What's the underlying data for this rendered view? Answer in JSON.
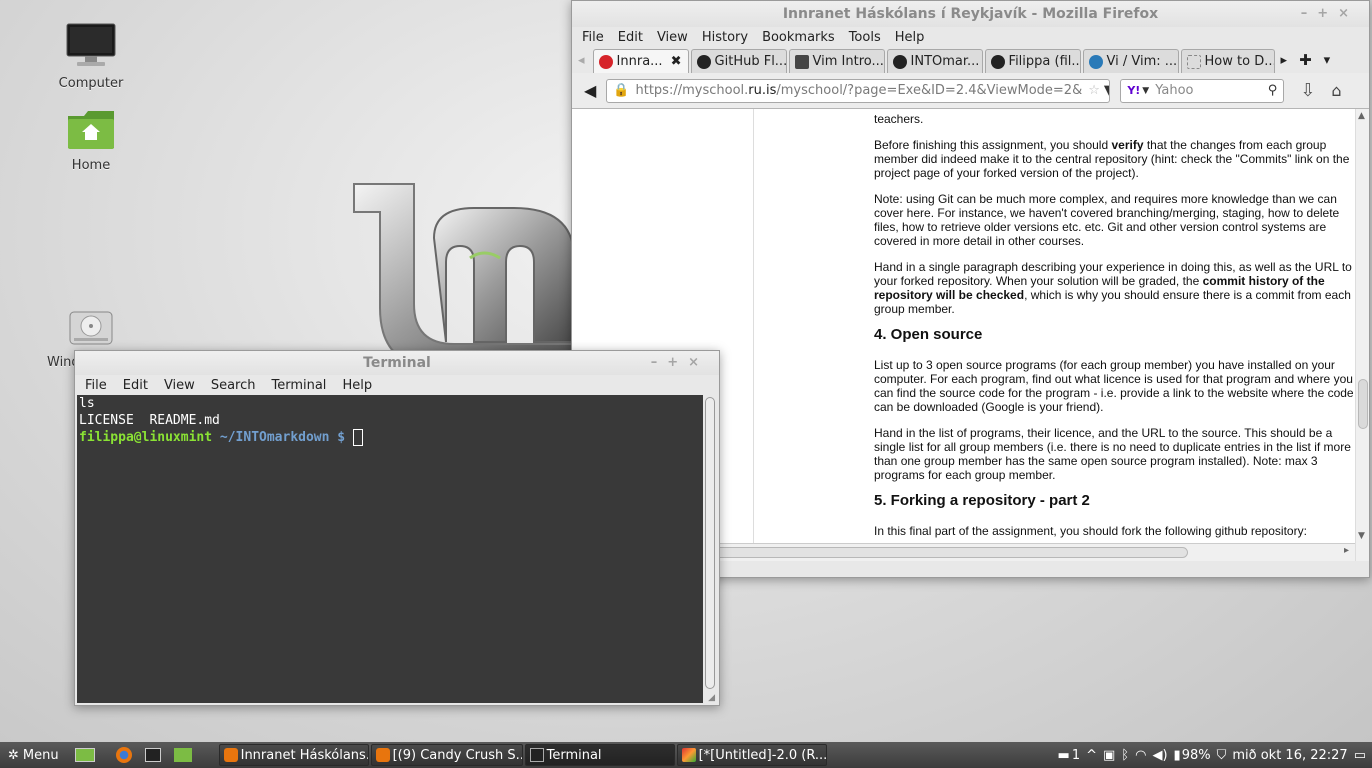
{
  "desktop": {
    "icons": [
      {
        "label": "Computer"
      },
      {
        "label": "Home"
      },
      {
        "label": "Wind"
      }
    ]
  },
  "firefox": {
    "title": "Innranet Háskólans í Reykjavík - Mozilla Firefox",
    "menu": [
      "File",
      "Edit",
      "View",
      "History",
      "Bookmarks",
      "Tools",
      "Help"
    ],
    "tabs": [
      {
        "label": "Innra...",
        "color": "#d6242a"
      },
      {
        "label": "GitHub Fl...",
        "color": "#222222"
      },
      {
        "label": "Vim Intro...",
        "color": "#444444"
      },
      {
        "label": "INTOmar...",
        "color": "#222222"
      },
      {
        "label": "Filippa (fil...",
        "color": "#222222"
      },
      {
        "label": "Vi / Vim: ...",
        "color": "#2a7ab8"
      },
      {
        "label": "How to D...",
        "color": "#cccccc"
      }
    ],
    "url": {
      "prefix": "https://myschool.",
      "domain": "ru.is",
      "rest": "/myschool/?page=Exe&ID=2.4&ViewMode=2&"
    },
    "search": {
      "engine_badge": "Y!",
      "placeholder": "Yahoo"
    },
    "article": {
      "p_top": "teachers.",
      "p_verify_1": "Before finishing this assignment, you should ",
      "p_verify_bold": "verify",
      "p_verify_2": " that the changes from each group member did indeed make it to the central repository (hint: check the \"Commits\" link on the project page of your forked version of the project).",
      "p_note": "Note: using Git can be much more complex, and requires more knowledge than we can cover here. For instance, we haven't covered branching/merging, staging, how to delete files, how to retrieve older versions etc. etc. Git and other version control systems are covered in more detail in other courses.",
      "p_handin_1": "Hand in a single paragraph describing your experience in doing this, as well as the URL to your forked repository. When your solution will be graded, the ",
      "p_handin_bold": "commit history of the repository will be checked",
      "p_handin_2": ", which is why you should ensure there is a commit from each group member.",
      "h_open_source": "4. Open source",
      "p_list": "List up to 3 open source programs (for each group member) you have installed on your computer. For each program, find out what licence is used for that program and where you can find the source code for the program - i.e. provide a link to the website where the code can be downloaded (Google is your friend).",
      "p_handin_list": "Hand in the list of programs, their licence, and the URL to the source. This should be a single list for all group members (i.e. there is no need to duplicate entries in the list if more than one group member has the same open source program installed). Note: max 3 programs for each group member.",
      "h_forking": "5. Forking a repository - part 2",
      "p_final": "In this final part of the assignment, you should fork the following github repository:"
    }
  },
  "terminal": {
    "title": "Terminal",
    "menu": [
      "File",
      "Edit",
      "View",
      "Search",
      "Terminal",
      "Help"
    ],
    "line1": "ls",
    "line2": "LICENSE  README.md",
    "prompt_user": "filippa@linuxmint",
    "prompt_path": " ~/INTOmarkdown $ "
  },
  "taskbar": {
    "menu_label": "Menu",
    "windows": [
      {
        "label": "Innranet Háskólans..."
      },
      {
        "label": "[(9) Candy Crush S..."
      },
      {
        "label": "Terminal"
      },
      {
        "label": "[*[Untitled]-2.0 (R..."
      }
    ],
    "tray": {
      "notifications": "1",
      "battery": "98%",
      "clock": "mið okt 16, 22:27"
    }
  }
}
